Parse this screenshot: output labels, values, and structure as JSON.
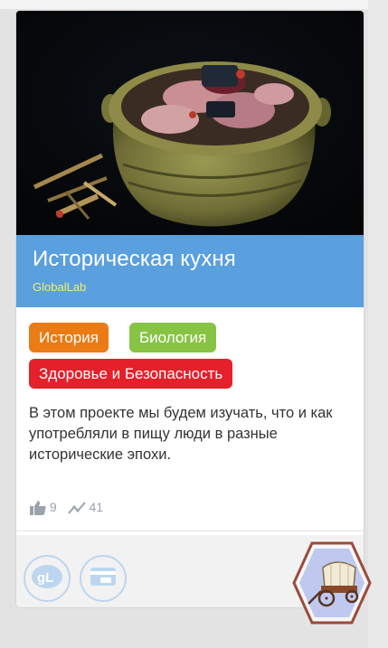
{
  "project": {
    "title": "Историческая кухня",
    "organization": "GlobalLab",
    "tags": [
      {
        "label": "История",
        "color": "#ea7b15"
      },
      {
        "label": "Биология",
        "color": "#88c444"
      },
      {
        "label": "Здоровье и Безопасность",
        "color": "#e5202a"
      }
    ],
    "description": "В этом проекте мы будем изучать, что и как употребляли в пищу люди в разные исторические эпохи.",
    "likes": "9",
    "views": "41"
  },
  "icons": {
    "like": "thumbs-up-icon",
    "views": "trend-icon",
    "globallab": "globallab-logo-icon",
    "card": "payment-card-icon",
    "badge": "covered-wagon-icon"
  },
  "colors": {
    "banner": "#5a9fde",
    "org_text": "#f4f06a",
    "hex_border": "#9b4a3c",
    "hex_fill": "#bfc9f0"
  }
}
